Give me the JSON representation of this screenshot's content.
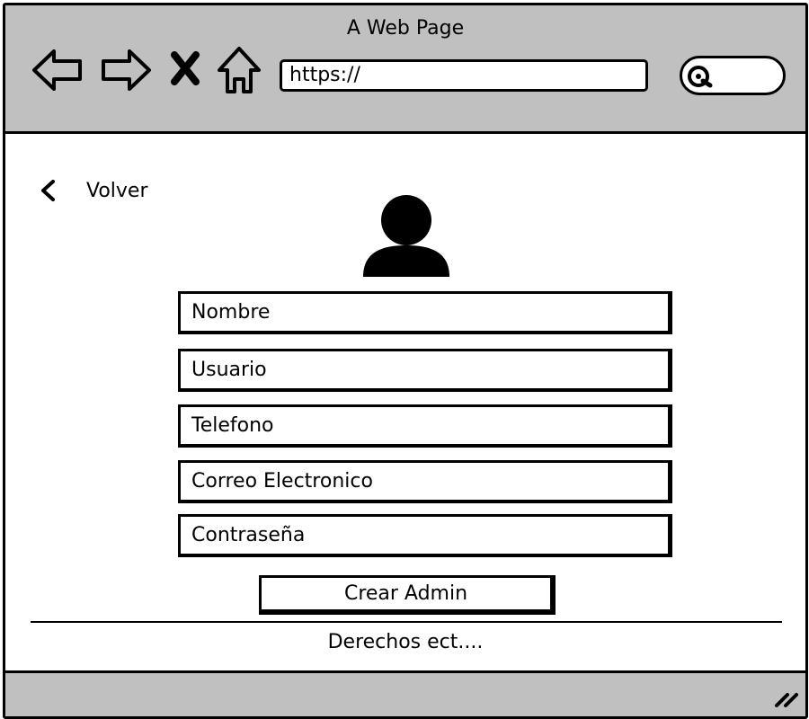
{
  "browser": {
    "title": "A Web Page",
    "url": "https://",
    "icons": [
      "arrow-left-icon",
      "arrow-right-icon",
      "close-icon",
      "home-icon",
      "search-icon"
    ]
  },
  "page": {
    "back_label": "Volver",
    "avatar_icon": "user-icon",
    "fields": {
      "nombre": "Nombre",
      "usuario": "Usuario",
      "telefono": "Telefono",
      "correo": "Correo Electronico",
      "contrasena": "Contraseña"
    },
    "submit_label": "Crear Admin",
    "footer_text": "Derechos ect...."
  },
  "colors": {
    "chrome_gray": "#c0c0c0",
    "ink": "#000000",
    "background": "#ffffff"
  }
}
